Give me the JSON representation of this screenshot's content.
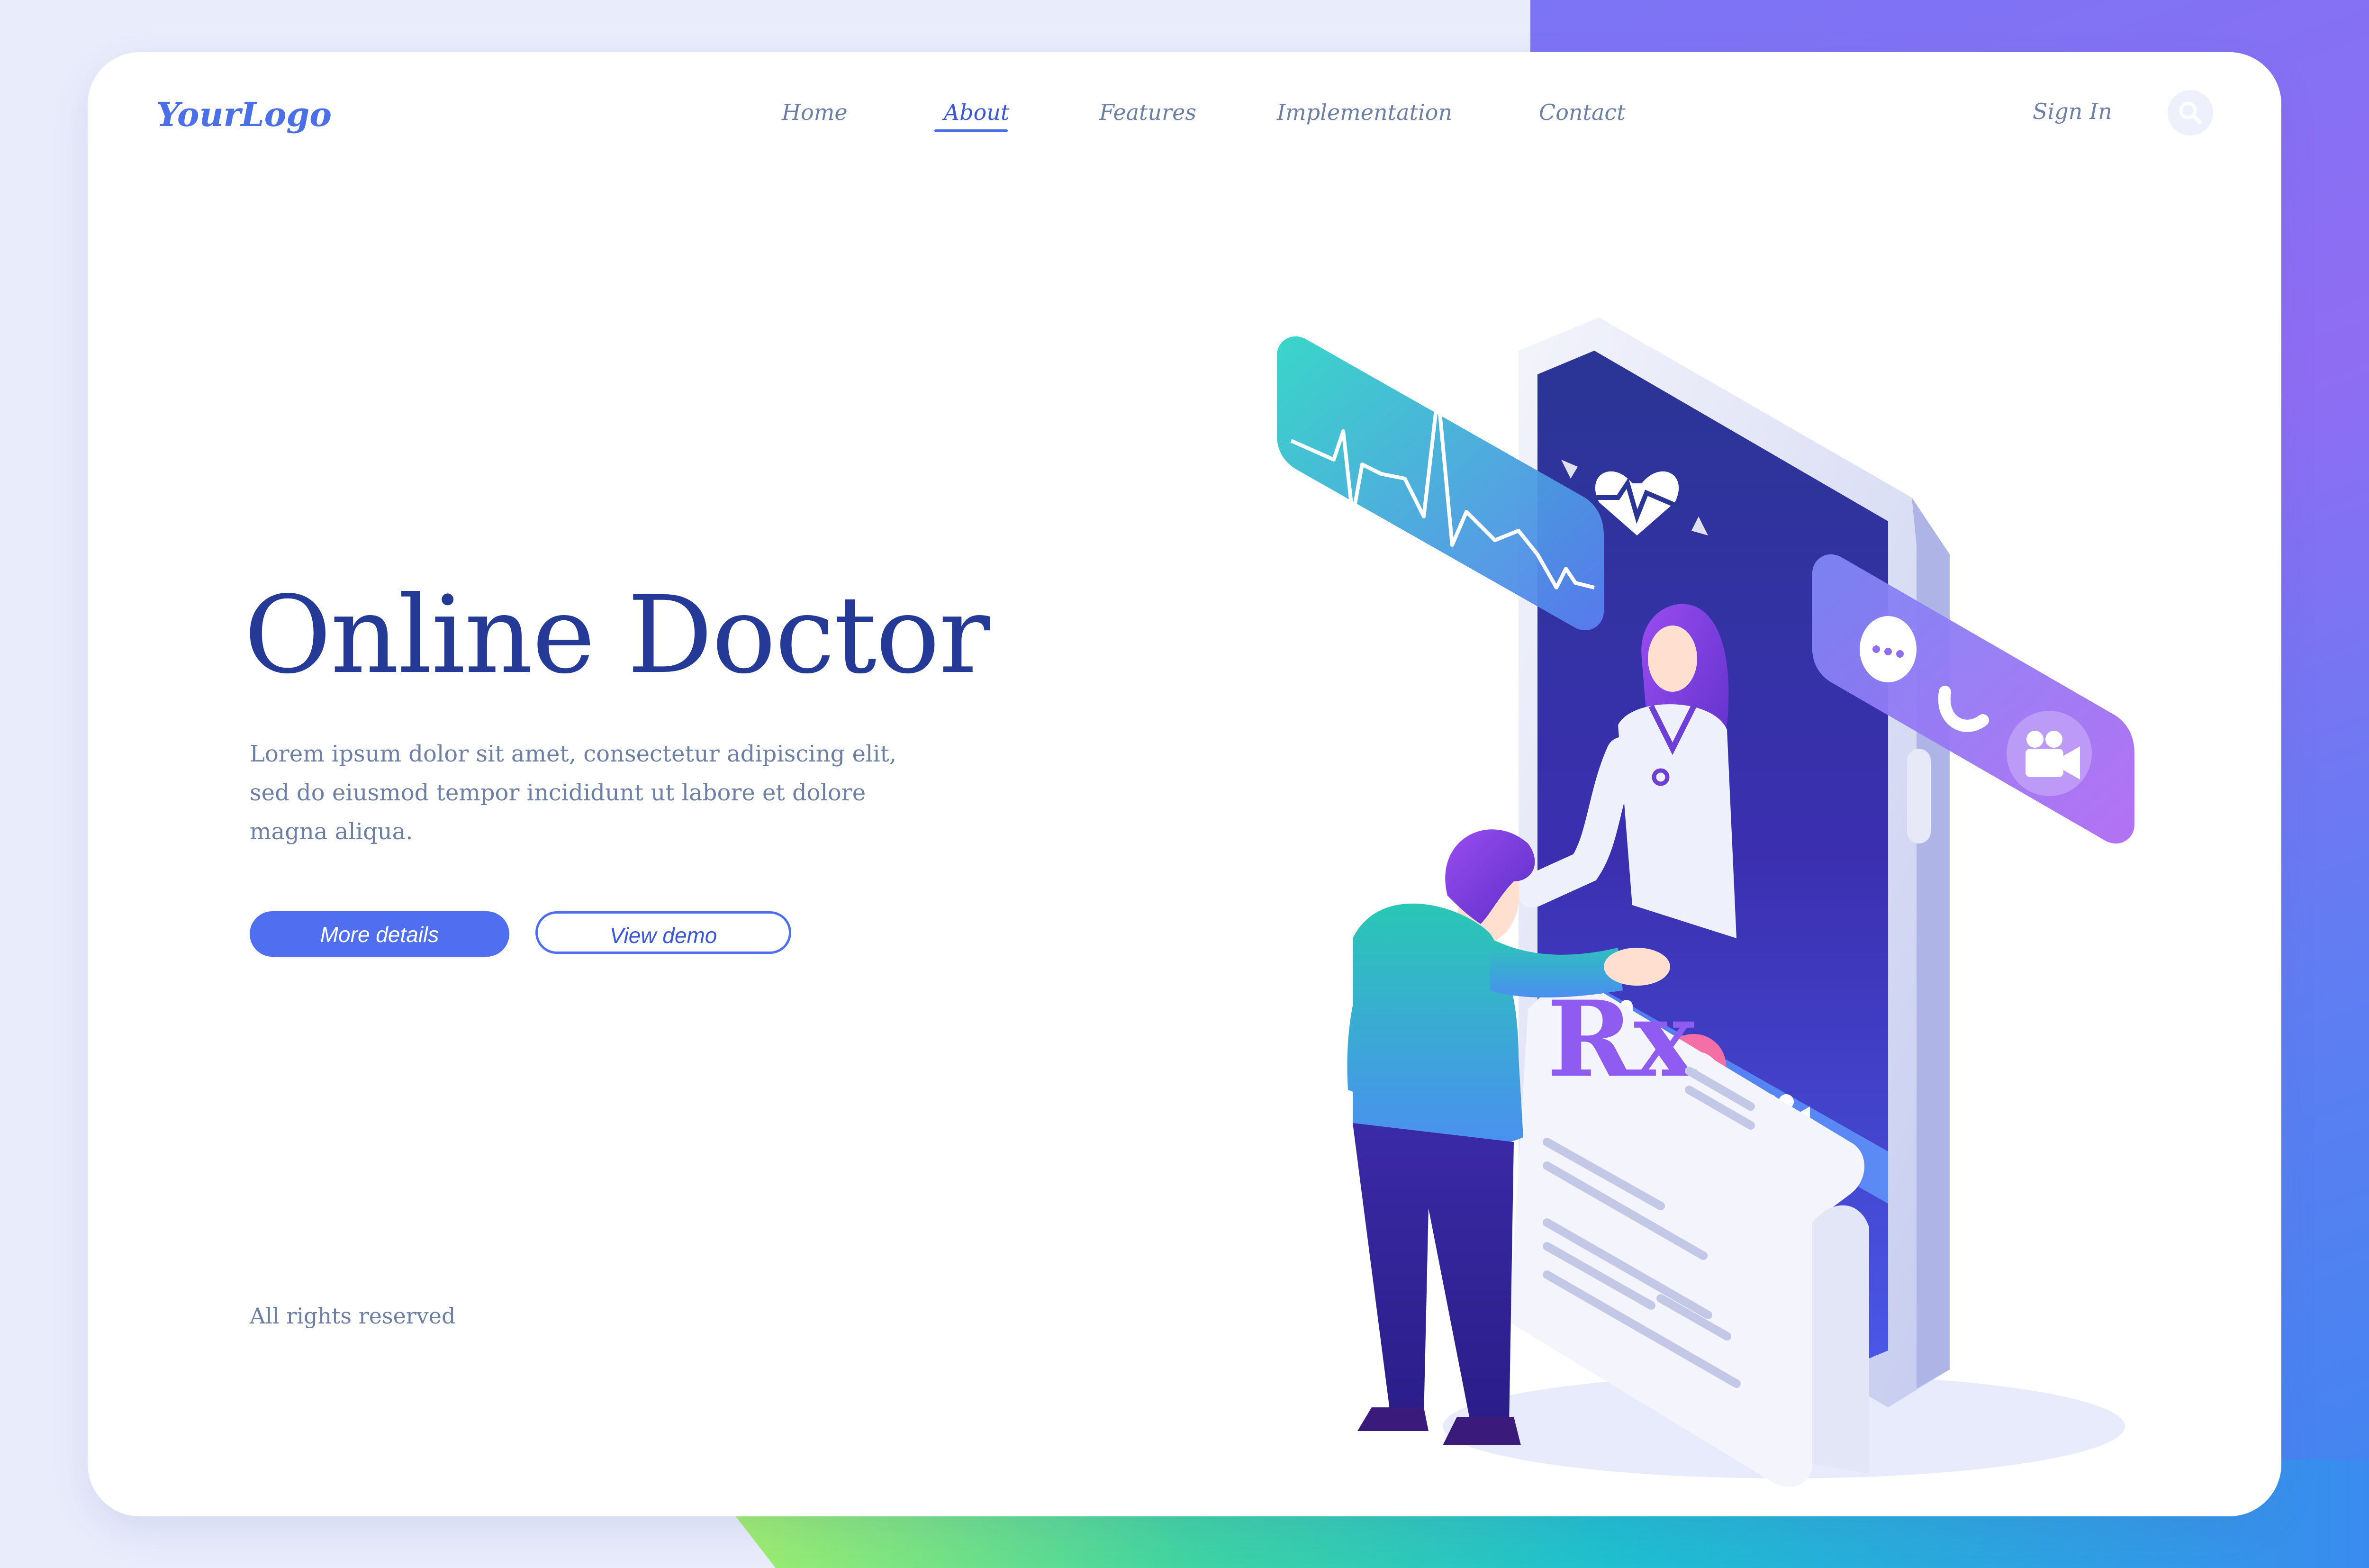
{
  "brand": {
    "logo": "YourLogo"
  },
  "nav": {
    "items": [
      {
        "label": "Home"
      },
      {
        "label": "About",
        "active": true
      },
      {
        "label": "Features"
      },
      {
        "label": "Implementation"
      },
      {
        "label": "Contact"
      }
    ],
    "sign_in": "Sign In",
    "search_icon": "search-icon"
  },
  "hero": {
    "title": "Online Doctor",
    "description_lines": [
      "Lorem ipsum dolor sit amet, consectetur adipiscing elit,",
      "sed do eiusmod tempor incididunt ut labore et dolore",
      "magna aliqua."
    ],
    "primary_button": "More details",
    "secondary_button": "View demo"
  },
  "footer": {
    "text": "All rights reserved"
  },
  "illustration": {
    "prescription_symbol": "Rx",
    "icons": [
      "heart-rate-icon",
      "chat-icon",
      "phone-icon",
      "video-camera-icon",
      "microphone-icon",
      "end-call-icon"
    ]
  },
  "colors": {
    "accent": "#4f6ff0",
    "title": "#243a96",
    "text_muted": "#6e7fa6"
  }
}
